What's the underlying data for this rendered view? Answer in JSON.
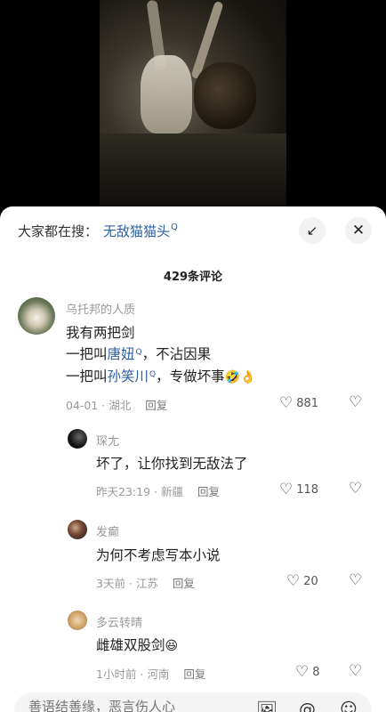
{
  "search": {
    "prefix": "大家都在搜：",
    "term": "无敌猫猫头",
    "q_mark": "Q"
  },
  "buttons": {
    "expand_icon": "↙",
    "close_icon": "✕"
  },
  "comment_count": "429条评论",
  "comments": [
    {
      "user": "乌托邦的人质",
      "lines": [
        {
          "text": "我有两把剑"
        },
        {
          "pre": "一把叫",
          "link": "唐妞",
          "post": "，不沾因果"
        },
        {
          "pre": "一把叫",
          "link": "孙笑川",
          "post": "，专做坏事",
          "emoji": "🤣👌"
        }
      ],
      "date": "04-01 · 湖北",
      "reply": "回复",
      "likes": "881"
    },
    {
      "user": "琛尢",
      "text": "坏了，让你找到无敌法了",
      "date": "昨天23:19 · 新疆",
      "reply": "回复",
      "likes": "118"
    },
    {
      "user": "发癫",
      "text": "为何不考虑写本小说",
      "date": "3天前 · 江苏",
      "reply": "回复",
      "likes": "20"
    },
    {
      "user": "多云转晴",
      "text": "雌雄双股剑",
      "emoji": "😆",
      "date": "1小时前 · 河南",
      "reply": "回复",
      "likes": "8"
    }
  ],
  "composer": {
    "placeholder": "善语结善缘，恶言伤人心"
  },
  "icons": {
    "heart": "♡",
    "dislike": "💔",
    "image": "🖼",
    "at": "@",
    "emoji": "☺"
  }
}
